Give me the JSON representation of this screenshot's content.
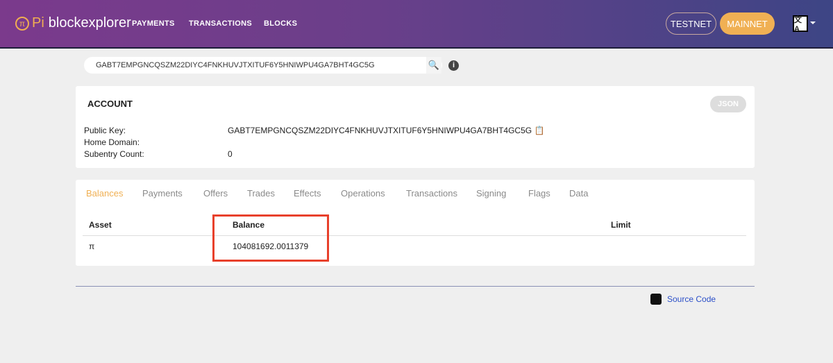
{
  "nav": {
    "logo_pi": "Pi",
    "logo_text": "blockexplorer",
    "links": [
      "PAYMENTS",
      "TRANSACTIONS",
      "BLOCKS"
    ],
    "testnet": "TESTNET",
    "mainnet": "MAINNET",
    "lang_icon": "language-icon"
  },
  "search": {
    "value": "GABT7EMPGNCQSZM22DIYC4FNKHUVJTXITUF6Y5HNIWPU4GA7BHT4GC5G"
  },
  "account": {
    "title": "ACCOUNT",
    "json_label": "JSON",
    "fields": [
      {
        "label": "Public Key:",
        "value": "GABT7EMPGNCQSZM22DIYC4FNKHUVJTXITUF6Y5HNIWPU4GA7BHT4GC5G"
      },
      {
        "label": "Home Domain:",
        "value": ""
      },
      {
        "label": "Subentry Count:",
        "value": "0"
      }
    ]
  },
  "tabs": [
    "Balances",
    "Payments",
    "Offers",
    "Trades",
    "Effects",
    "Operations",
    "Transactions",
    "Signing",
    "Flags",
    "Data"
  ],
  "balances": {
    "headers": [
      "Asset",
      "Balance",
      "Limit"
    ],
    "rows": [
      {
        "asset": "π",
        "balance": "104081692.0011379",
        "limit": ""
      }
    ]
  },
  "footer": {
    "source_code": "Source Code"
  },
  "colors": {
    "accent": "#f0b054",
    "highlight": "#e8402b"
  }
}
